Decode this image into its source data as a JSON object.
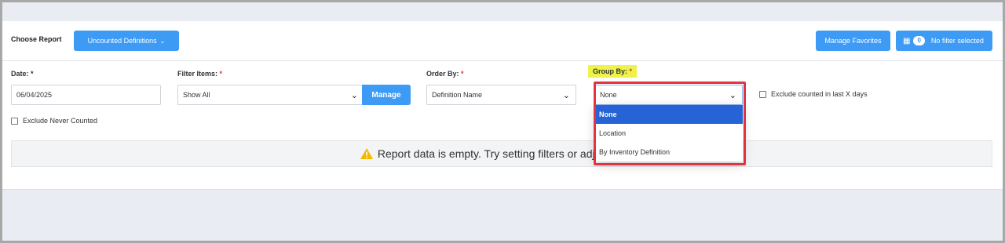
{
  "header": {
    "choose_report_label": "Choose Report",
    "report_button_label": "Uncounted Definitions",
    "manage_favorites_label": "Manage Favorites",
    "filter_count": "0",
    "filter_status_label": "No filter selected"
  },
  "filters": {
    "date_label": "Date: *",
    "date_value": "06/04/2025",
    "filter_items_label": "Filter Items: ",
    "filter_items_value": "Show All",
    "manage_button_label": "Manage",
    "order_by_label": "Order By: ",
    "order_by_value": "Definition Name",
    "group_by_label": "Group By: ",
    "group_by_value": "None",
    "required_mark": "*",
    "exclude_counted_label": "Exclude counted in last X days",
    "exclude_never_label": "Exclude Never Counted"
  },
  "group_by_options": [
    "None",
    "Location",
    "By Inventory Definition"
  ],
  "empty_message": "Report data is empty. Try setting filters or adjust the da",
  "colors": {
    "primary": "#3d9bf5",
    "selected_option": "#2563d6",
    "highlight_border": "#e2343f",
    "label_highlight": "#eef34a",
    "warning": "#f5b800"
  },
  "icons": {
    "warning": "warning-triangle-icon",
    "filter": "filter-icon",
    "caret": "chevron-down-icon"
  }
}
